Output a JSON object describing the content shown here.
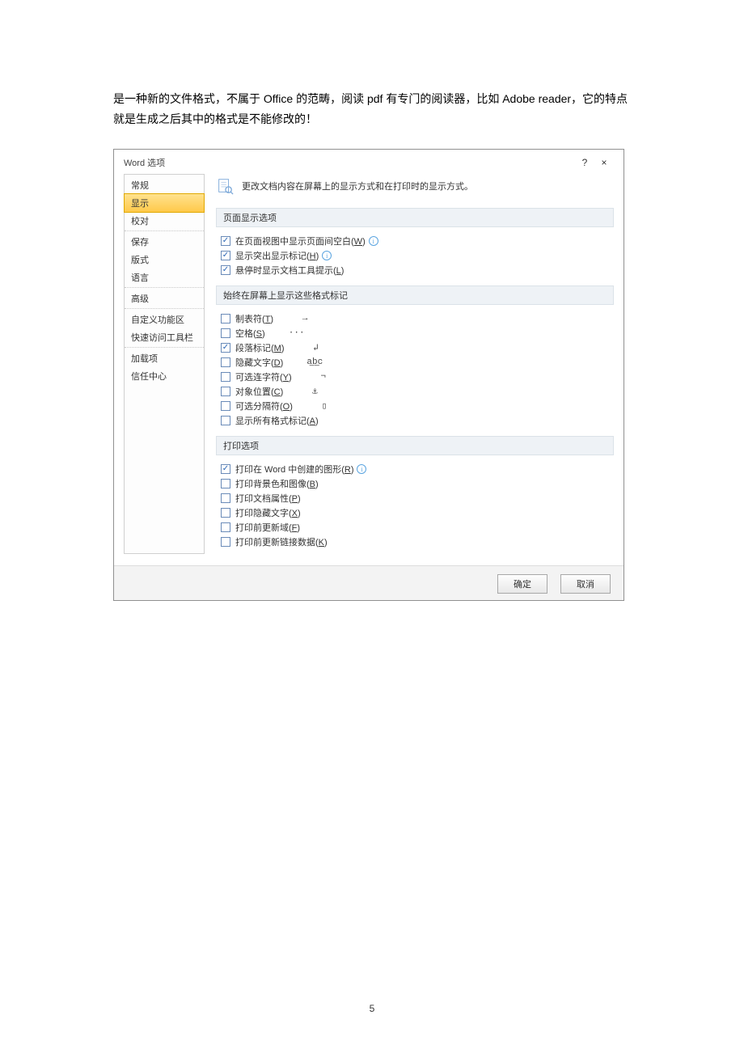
{
  "intro_text": "是一种新的文件格式，不属于 Office 的范畴，阅读 pdf 有专门的阅读器，比如 Adobe reader，它的特点就是生成之后其中的格式是不能修改的！",
  "dialog": {
    "title": "Word 选项",
    "help_glyph": "?",
    "close_glyph": "×",
    "nav": [
      {
        "label": "常规",
        "sep": false
      },
      {
        "label": "显示",
        "sep": false,
        "selected": true
      },
      {
        "label": "校对",
        "sep": true
      },
      {
        "label": "保存",
        "sep": false
      },
      {
        "label": "版式",
        "sep": false
      },
      {
        "label": "语言",
        "sep": true
      },
      {
        "label": "高级",
        "sep": true
      },
      {
        "label": "自定义功能区",
        "sep": false
      },
      {
        "label": "快速访问工具栏",
        "sep": true
      },
      {
        "label": "加载项",
        "sep": false
      },
      {
        "label": "信任中心",
        "sep": false
      }
    ],
    "description": "更改文档内容在屏幕上的显示方式和在打印时的显示方式。",
    "sections": {
      "page_display": {
        "header": "页面显示选项",
        "items": [
          {
            "pre": "在页面视图中显示页面间空白(",
            "u": "W",
            "post": ")",
            "checked": true,
            "info": true
          },
          {
            "pre": "显示突出显示标记(",
            "u": "H",
            "post": ")",
            "checked": true,
            "info": true
          },
          {
            "pre": "悬停时显示文档工具提示(",
            "u": "L",
            "post": ")",
            "checked": true
          }
        ]
      },
      "format_marks": {
        "header": "始终在屏幕上显示这些格式标记",
        "items": [
          {
            "pre": "制表符(",
            "u": "T",
            "post": ")",
            "checked": false,
            "sym": "→"
          },
          {
            "pre": "空格(",
            "u": "S",
            "post": ")",
            "checked": false,
            "sym": "···"
          },
          {
            "pre": "段落标记(",
            "u": "M",
            "post": ")",
            "checked": true,
            "sym": "↲"
          },
          {
            "pre": "隐藏文字(",
            "u": "D",
            "post": ")",
            "checked": false,
            "sym": "a͟b͟c"
          },
          {
            "pre": "可选连字符(",
            "u": "Y",
            "post": ")",
            "checked": false,
            "sym": "¬"
          },
          {
            "pre": "对象位置(",
            "u": "C",
            "post": ")",
            "checked": false,
            "sym": "⚓"
          },
          {
            "pre": "可选分隔符(",
            "u": "O",
            "post": ")",
            "checked": false,
            "sym": "▯"
          },
          {
            "pre": "显示所有格式标记(",
            "u": "A",
            "post": ")",
            "checked": false
          }
        ]
      },
      "print": {
        "header": "打印选项",
        "items": [
          {
            "pre": "打印在 Word 中创建的图形(",
            "u": "R",
            "post": ")",
            "checked": true,
            "info": true
          },
          {
            "pre": "打印背景色和图像(",
            "u": "B",
            "post": ")",
            "checked": false
          },
          {
            "pre": "打印文档属性(",
            "u": "P",
            "post": ")",
            "checked": false
          },
          {
            "pre": "打印隐藏文字(",
            "u": "X",
            "post": ")",
            "checked": false
          },
          {
            "pre": "打印前更新域(",
            "u": "F",
            "post": ")",
            "checked": false
          },
          {
            "pre": "打印前更新链接数据(",
            "u": "K",
            "post": ")",
            "checked": false
          }
        ]
      }
    },
    "ok_label": "确定",
    "cancel_label": "取消"
  },
  "page_number": "5"
}
